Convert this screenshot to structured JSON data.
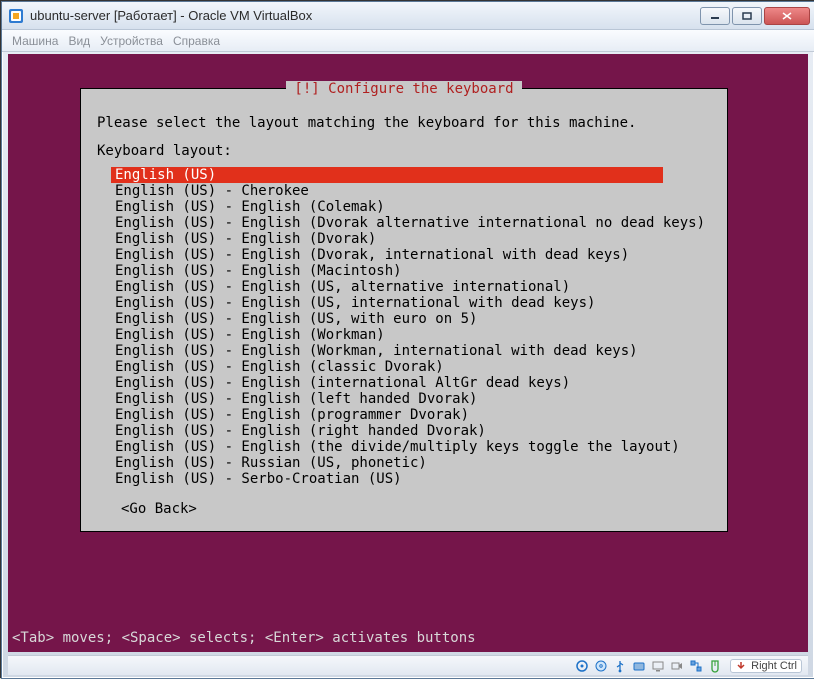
{
  "window": {
    "title": "ubuntu-server [Работает] - Oracle VM VirtualBox"
  },
  "menu": {
    "machine": "Машина",
    "view": "Вид",
    "devices": "Устройства",
    "help": "Справка"
  },
  "dialog": {
    "title": "[!] Configure the keyboard",
    "prompt": "Please select the layout matching the keyboard for this machine.",
    "list_label": "Keyboard layout:",
    "go_back": "<Go Back>",
    "layouts": [
      "English (US)",
      "English (US) - Cherokee",
      "English (US) - English (Colemak)",
      "English (US) - English (Dvorak alternative international no dead keys)",
      "English (US) - English (Dvorak)",
      "English (US) - English (Dvorak, international with dead keys)",
      "English (US) - English (Macintosh)",
      "English (US) - English (US, alternative international)",
      "English (US) - English (US, international with dead keys)",
      "English (US) - English (US, with euro on 5)",
      "English (US) - English (Workman)",
      "English (US) - English (Workman, international with dead keys)",
      "English (US) - English (classic Dvorak)",
      "English (US) - English (international AltGr dead keys)",
      "English (US) - English (left handed Dvorak)",
      "English (US) - English (programmer Dvorak)",
      "English (US) - English (right handed Dvorak)",
      "English (US) - English (the divide/multiply keys toggle the layout)",
      "English (US) - Russian (US, phonetic)",
      "English (US) - Serbo-Croatian (US)"
    ],
    "selected_index": 0
  },
  "hint": "<Tab> moves; <Space> selects; <Enter> activates buttons",
  "status": {
    "host_key": "Right Ctrl"
  }
}
